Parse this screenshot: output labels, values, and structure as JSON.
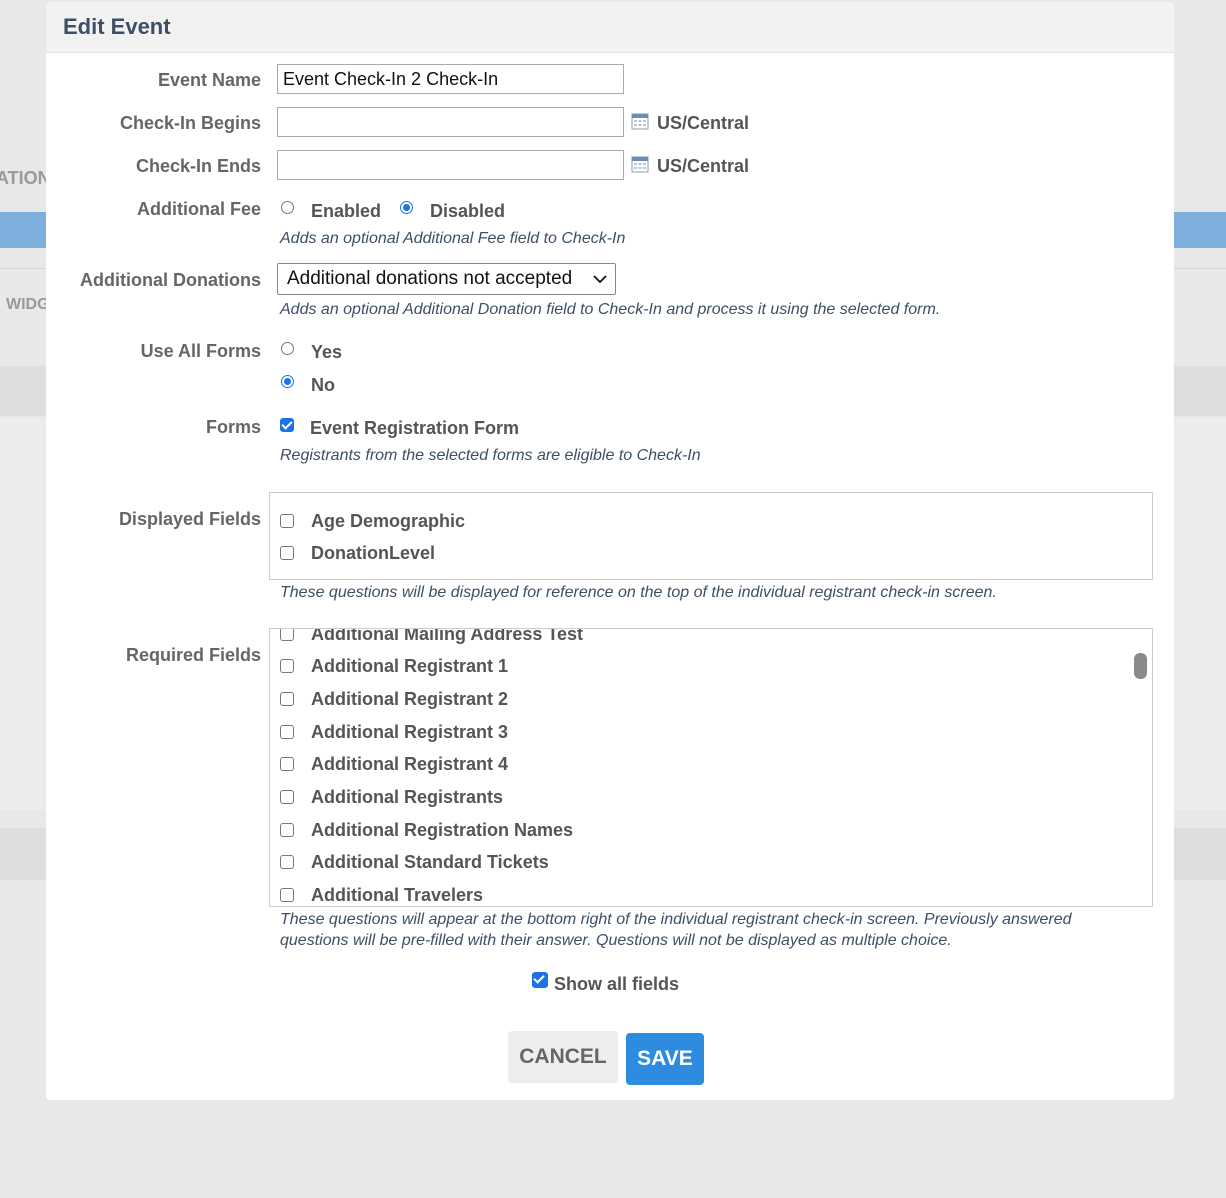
{
  "background": {
    "fragment_ation": "ATION",
    "fragment_widg": "WIDG"
  },
  "modal": {
    "title": "Edit Event",
    "event_name": {
      "label": "Event Name",
      "value": "Event Check-In 2 Check-In"
    },
    "checkin_begins": {
      "label": "Check-In Begins",
      "value": "",
      "timezone": "US/Central"
    },
    "checkin_ends": {
      "label": "Check-In Ends",
      "value": "",
      "timezone": "US/Central"
    },
    "additional_fee": {
      "label": "Additional Fee",
      "options": [
        "Enabled",
        "Disabled"
      ],
      "selected": "Disabled",
      "help": "Adds an optional Additional Fee field to Check-In"
    },
    "additional_donations": {
      "label": "Additional Donations",
      "selected": "Additional donations not accepted",
      "help": "Adds an optional Additional Donation field to Check-In and process it using the selected form."
    },
    "use_all_forms": {
      "label": "Use All Forms",
      "options": [
        "Yes",
        "No"
      ],
      "selected": "No"
    },
    "forms": {
      "label": "Forms",
      "items": [
        {
          "label": "Event Registration Form",
          "checked": true
        }
      ],
      "help": "Registrants from the selected forms are eligible to Check-In"
    },
    "displayed_fields": {
      "label": "Displayed Fields",
      "items": [
        {
          "label": "Age Demographic",
          "checked": false
        },
        {
          "label": "DonationLevel",
          "checked": false
        }
      ],
      "help": "These questions will be displayed for reference on the top of the individual registrant check-in screen."
    },
    "required_fields": {
      "label": "Required Fields",
      "items": [
        {
          "label": "Additional Mailing Address Test",
          "checked": false
        },
        {
          "label": "Additional Registrant 1",
          "checked": false
        },
        {
          "label": "Additional Registrant 2",
          "checked": false
        },
        {
          "label": "Additional Registrant 3",
          "checked": false
        },
        {
          "label": "Additional Registrant 4",
          "checked": false
        },
        {
          "label": "Additional Registrants",
          "checked": false
        },
        {
          "label": "Additional Registration Names",
          "checked": false
        },
        {
          "label": "Additional Standard Tickets",
          "checked": false
        },
        {
          "label": "Additional Travelers",
          "checked": false
        }
      ],
      "help_line1": "These questions will appear at the bottom right of the individual registrant check-in screen. Previously answered",
      "help_line2": "questions will be pre-filled with their answer. Questions will not be displayed as multiple choice."
    },
    "show_all_fields": {
      "label": "Show all fields",
      "checked": true
    },
    "buttons": {
      "cancel": "CANCEL",
      "save": "SAVE"
    }
  }
}
